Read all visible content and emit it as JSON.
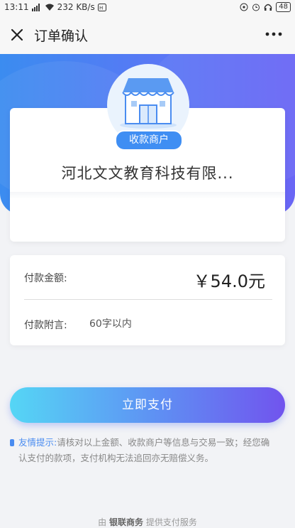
{
  "status_bar": {
    "time": "13:11",
    "network_speed": "232 KB/s",
    "battery": "48"
  },
  "nav": {
    "title": "订单确认",
    "close_icon": "close-icon",
    "more_icon": "more-icon"
  },
  "merchant": {
    "tag": "收款商户",
    "name": "河北文文教育科技有限...",
    "icon": "store-icon"
  },
  "payment": {
    "amount_label": "付款金额:",
    "amount_value": "￥54.0元",
    "note_label": "付款附言:",
    "note_placeholder": "60字以内"
  },
  "pay_button": {
    "label": "立即支付"
  },
  "tip": {
    "head": "友情提示:",
    "body": "请核对以上金额、收款商户等信息与交易一致；经您确认支付的款项，支付机构无法追回亦无赔偿义务。"
  },
  "footer": {
    "prefix": "由",
    "brand": "银联商务",
    "suffix": "提供支付服务"
  },
  "colors": {
    "accent": "#3f8ef3",
    "gradient_start": "#55d6f5",
    "gradient_end": "#7154ee"
  }
}
